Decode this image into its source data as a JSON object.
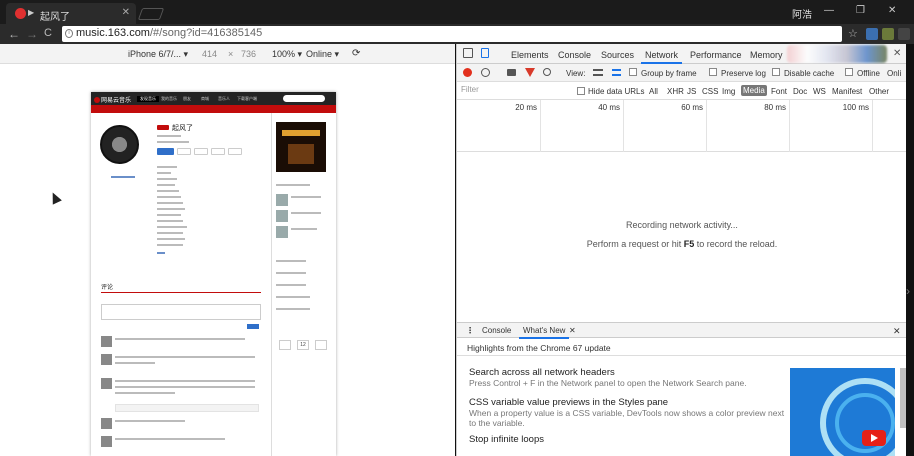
{
  "browser": {
    "tab_title": "起风了",
    "tab_close": "✕",
    "user_name": "阿浩",
    "window_controls": [
      "—",
      "❐",
      "✕"
    ],
    "url_host": "music.163.com",
    "url_path": "/#/song?id=416385145",
    "nav": [
      "←",
      "→",
      "C"
    ],
    "star": "☆"
  },
  "device_toolbar": {
    "device": "iPhone 6/7/... ▾",
    "width": "414",
    "times": "×",
    "height": "736",
    "zoom": "100% ▾",
    "network": "Online ▾",
    "rotate": "⟳"
  },
  "netease_page": {
    "logo": "网易云音乐",
    "nav": [
      "发现音乐",
      "我的音乐",
      "朋友",
      "商城",
      "音乐人",
      "下载客户端"
    ],
    "song_title": "起风了",
    "comment_heading": "评论",
    "pager_value": "12"
  },
  "devtools": {
    "tabs": [
      "Elements",
      "Console",
      "Sources",
      "Network",
      "Performance",
      "Memory"
    ],
    "active_tab": "Network",
    "toolbar": {
      "view_label": "View:",
      "group_by_frame": "Group by frame",
      "preserve_log": "Preserve log",
      "disable_cache": "Disable cache",
      "offline": "Offline",
      "online": "Onli"
    },
    "filter": {
      "placeholder": "Filter",
      "hide_data_urls": "Hide data URLs",
      "types": [
        "All",
        "XHR",
        "JS",
        "CSS",
        "Img",
        "Media",
        "Font",
        "Doc",
        "WS",
        "Manifest",
        "Other"
      ],
      "selected_type": "Media"
    },
    "timeline_ticks": [
      "20 ms",
      "40 ms",
      "60 ms",
      "80 ms",
      "100 ms"
    ],
    "recording_text": "Recording network activity...",
    "perform_prefix": "Perform a request or hit ",
    "perform_key": "F5",
    "perform_suffix": " to record the reload.",
    "drawer": {
      "menu": "⋮",
      "tabs": [
        "Console",
        "What's New"
      ],
      "whats_new_close": "✕",
      "close": "✕",
      "highlights": "Highlights from the Chrome 67 update",
      "items": [
        {
          "title": "Search across all network headers",
          "desc": "Press Control + F in the Network panel to open the Network Search pane."
        },
        {
          "title": "CSS variable value previews in the Styles pane",
          "desc": "When a property value is a CSS variable, DevTools now shows a color preview next to the variable."
        },
        {
          "title": "Stop infinite loops",
          "desc": ""
        }
      ]
    },
    "close": "✕"
  },
  "colors": {
    "accent": "#1a73e8",
    "record": "#e2301d",
    "netease_red": "#c20c0c"
  }
}
